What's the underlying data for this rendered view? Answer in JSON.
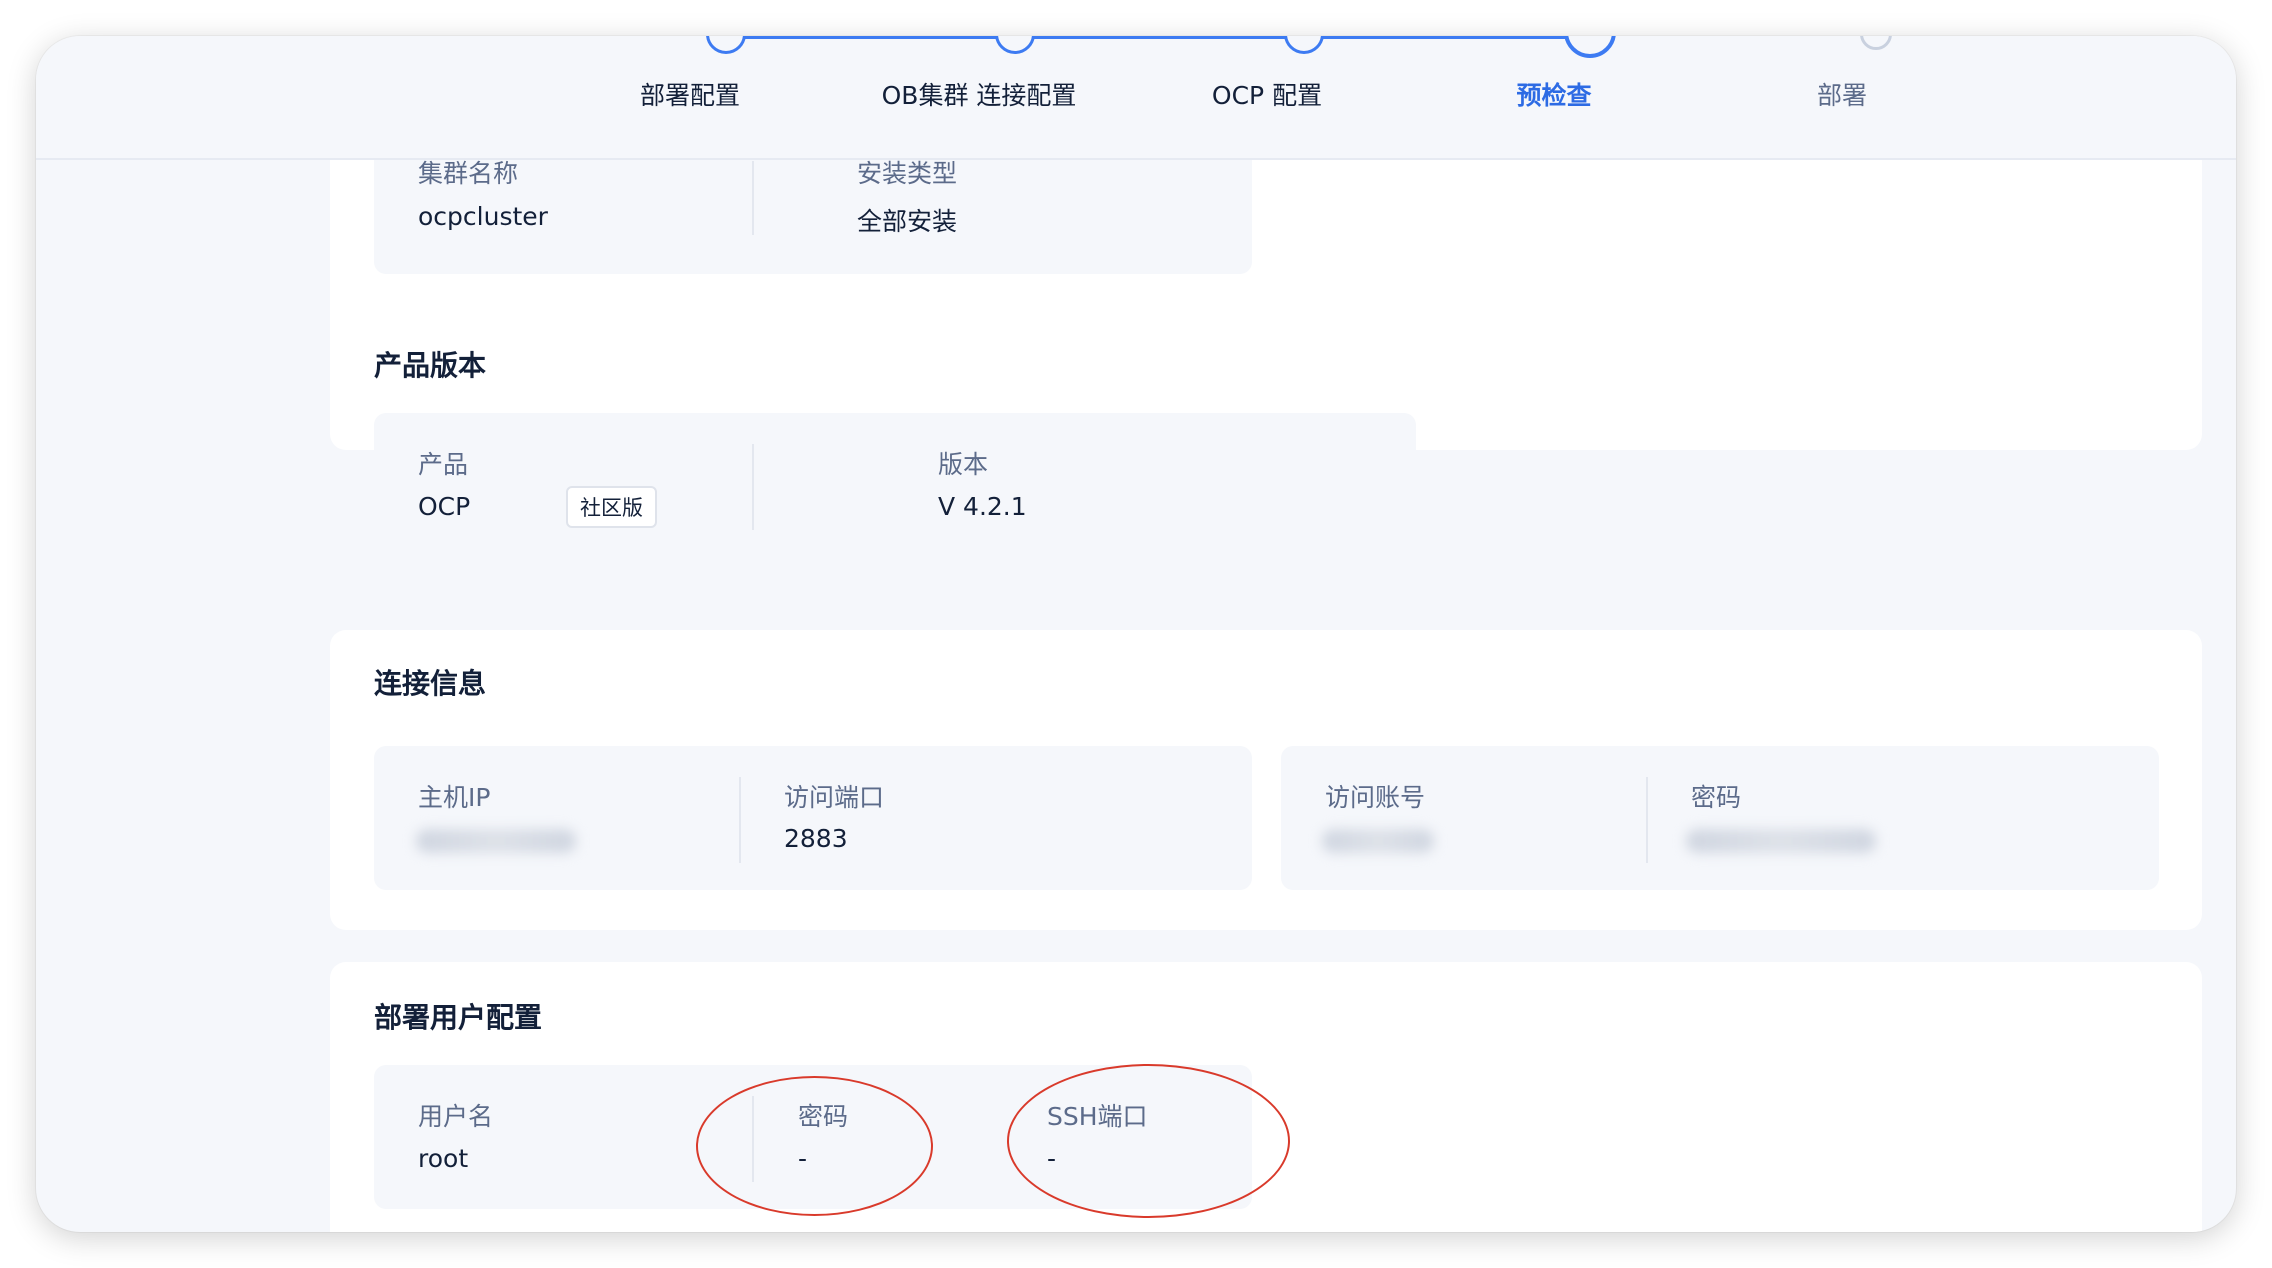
{
  "steps": [
    {
      "label": "部署配置",
      "state": "done"
    },
    {
      "label": "OB集群 连接配置",
      "state": "done"
    },
    {
      "label": "OCP 配置",
      "state": "done"
    },
    {
      "label": "预检查",
      "state": "current"
    },
    {
      "label": "部署",
      "state": "todo"
    }
  ],
  "cluster": {
    "name_label": "集群名称",
    "name_value": "ocpcluster",
    "type_label": "安装类型",
    "type_value": "全部安装"
  },
  "product_version": {
    "title": "产品版本",
    "product_label": "产品",
    "product_value": "OCP",
    "product_tag": "社区版",
    "version_label": "版本",
    "version_value": "V 4.2.1"
  },
  "connection": {
    "title": "连接信息",
    "host_label": "主机IP",
    "port_label": "访问端口",
    "port_value": "2883",
    "account_label": "访问账号",
    "password_label": "密码"
  },
  "deploy_user": {
    "title": "部署用户配置",
    "username_label": "用户名",
    "username_value": "root",
    "password_label": "密码",
    "password_value": "-",
    "ssh_label": "SSH端口",
    "ssh_value": "-"
  },
  "colors": {
    "accent": "#3d7bf2",
    "annotation": "#d93a2b"
  }
}
